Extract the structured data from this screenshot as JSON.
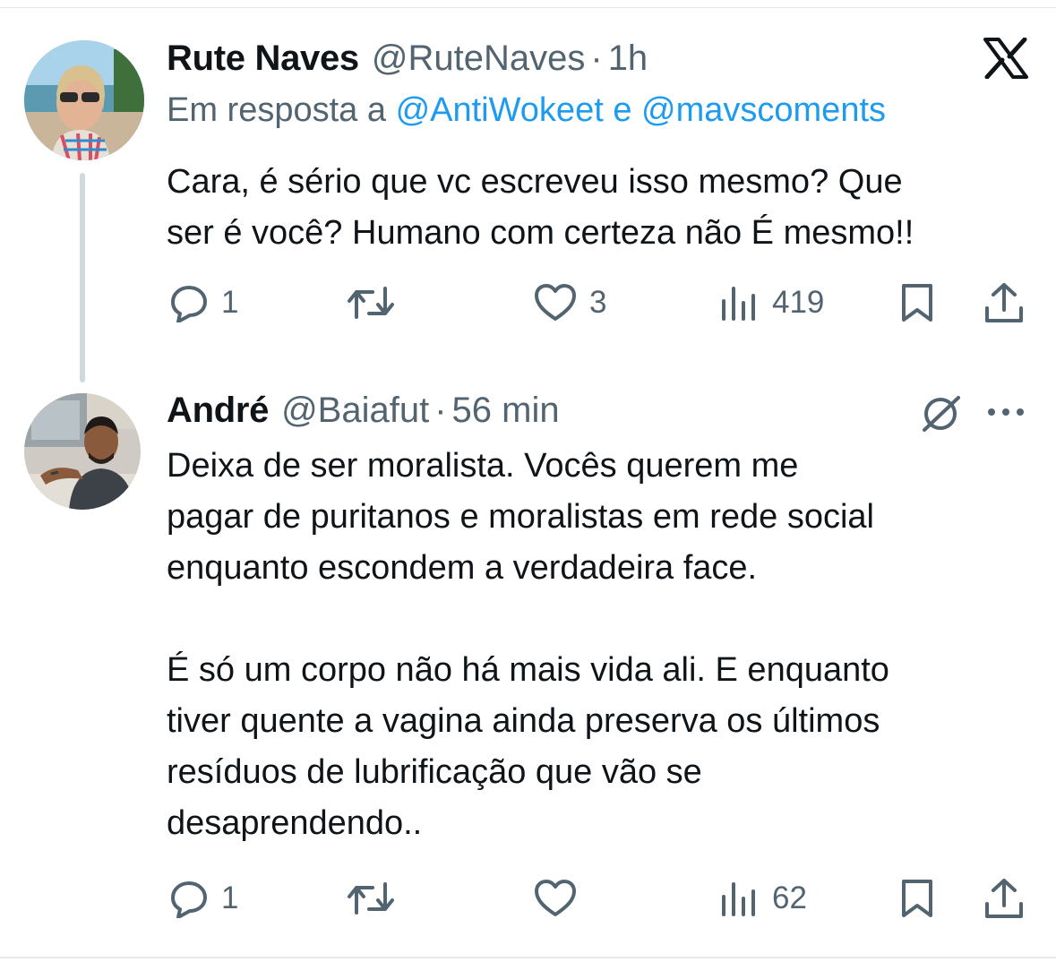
{
  "tweets": [
    {
      "author_name": "Rute Naves",
      "handle": "@RuteNaves",
      "separator": "·",
      "time": "1h",
      "reply_prefix": "Em resposta a",
      "mentions": [
        "@AntiWokeet",
        "@mavscoments"
      ],
      "reply_joiner": "e",
      "text": "Cara, é sério que vc escreveu isso mesmo? Que\nser é você? Humano com certeza não É mesmo!!",
      "replies": "1",
      "likes": "3",
      "views": "419"
    },
    {
      "author_name": "André",
      "handle": "@Baiafut",
      "separator": "·",
      "time": "56 min",
      "text": "Deixa de ser moralista. Vocês querem me\npagar de puritanos e moralistas em rede social\nenquanto escondem a verdadeira face.\n\nÉ só um corpo não há mais vida ali. E enquanto\ntiver quente a vagina ainda preserva os últimos\nresíduos de lubrificação que vão se\ndesaprendendo..",
      "replies": "1",
      "views": "62"
    }
  ],
  "icons": {
    "platform_logo": "x-logo-icon",
    "grok": "grok-icon",
    "more": "more-options-icon",
    "reply": "reply-icon",
    "retweet": "retweet-icon",
    "like": "like-icon",
    "views": "views-icon",
    "bookmark": "bookmark-icon",
    "share": "share-icon"
  },
  "colors": {
    "text_primary": "#0f1419",
    "text_secondary": "#536471",
    "link": "#1d9bf0",
    "thread_line": "#cfd9de"
  }
}
